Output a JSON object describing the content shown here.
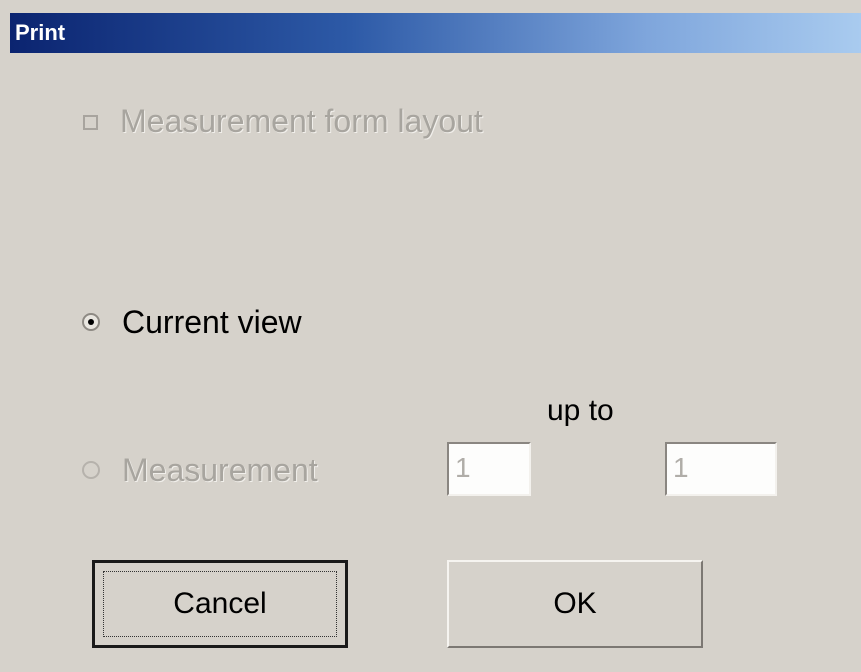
{
  "window": {
    "title": "Print"
  },
  "options": {
    "layout_checkbox": {
      "label": "Measurement form layout",
      "checked": false,
      "enabled": false
    },
    "current_view_radio": {
      "label": "Current view",
      "checked": true,
      "enabled": true
    },
    "measurement_radio": {
      "label": "Measurement",
      "checked": false,
      "enabled": false
    }
  },
  "range": {
    "from_value": "1",
    "up_to_label": "up to",
    "to_value": "1"
  },
  "buttons": {
    "cancel_label": "Cancel",
    "ok_label": "OK"
  }
}
